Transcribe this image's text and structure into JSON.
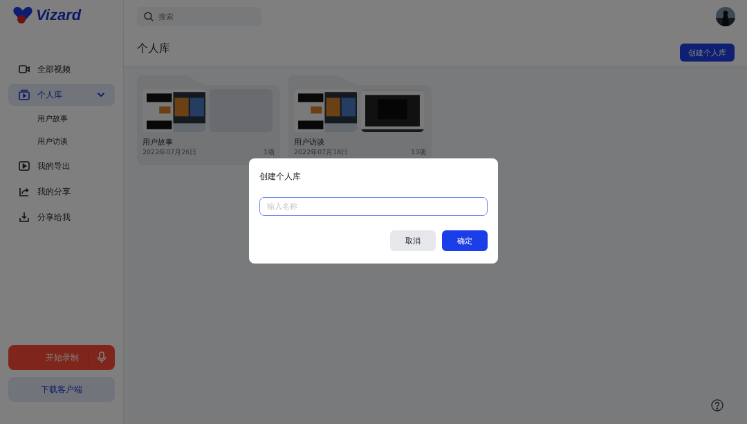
{
  "logo": {
    "text": "Vizard"
  },
  "search": {
    "placeholder": "搜索"
  },
  "page_title": "个人库",
  "create_button": "创建个人库",
  "sidebar": {
    "items": [
      {
        "label": "全部视频",
        "selected": false
      },
      {
        "label": "个人库",
        "selected": true,
        "expanded": true,
        "children": [
          {
            "label": "用户故事"
          },
          {
            "label": "用户访谈"
          }
        ]
      },
      {
        "label": "我的导出",
        "selected": false
      },
      {
        "label": "我的分享",
        "selected": false
      },
      {
        "label": "分享给我",
        "selected": false
      }
    ]
  },
  "record_button": "开始录制",
  "download_button": "下载客户端",
  "folders": [
    {
      "name": "用户故事",
      "date": "2022年07月26日",
      "count": "1项",
      "thumbnails": [
        {
          "kind": "picture"
        },
        {
          "kind": "empty"
        }
      ]
    },
    {
      "name": "用户访谈",
      "date": "2022年07月18日",
      "count": "13项",
      "thumbnails": [
        {
          "kind": "picture"
        },
        {
          "kind": "picture"
        }
      ]
    }
  ],
  "dialog": {
    "title": "创建个人库",
    "input": {
      "placeholder": "输入名称"
    },
    "buttons": [
      {
        "label": "取消",
        "kind": "secondary"
      },
      {
        "label": "确定",
        "kind": "primary"
      }
    ]
  }
}
